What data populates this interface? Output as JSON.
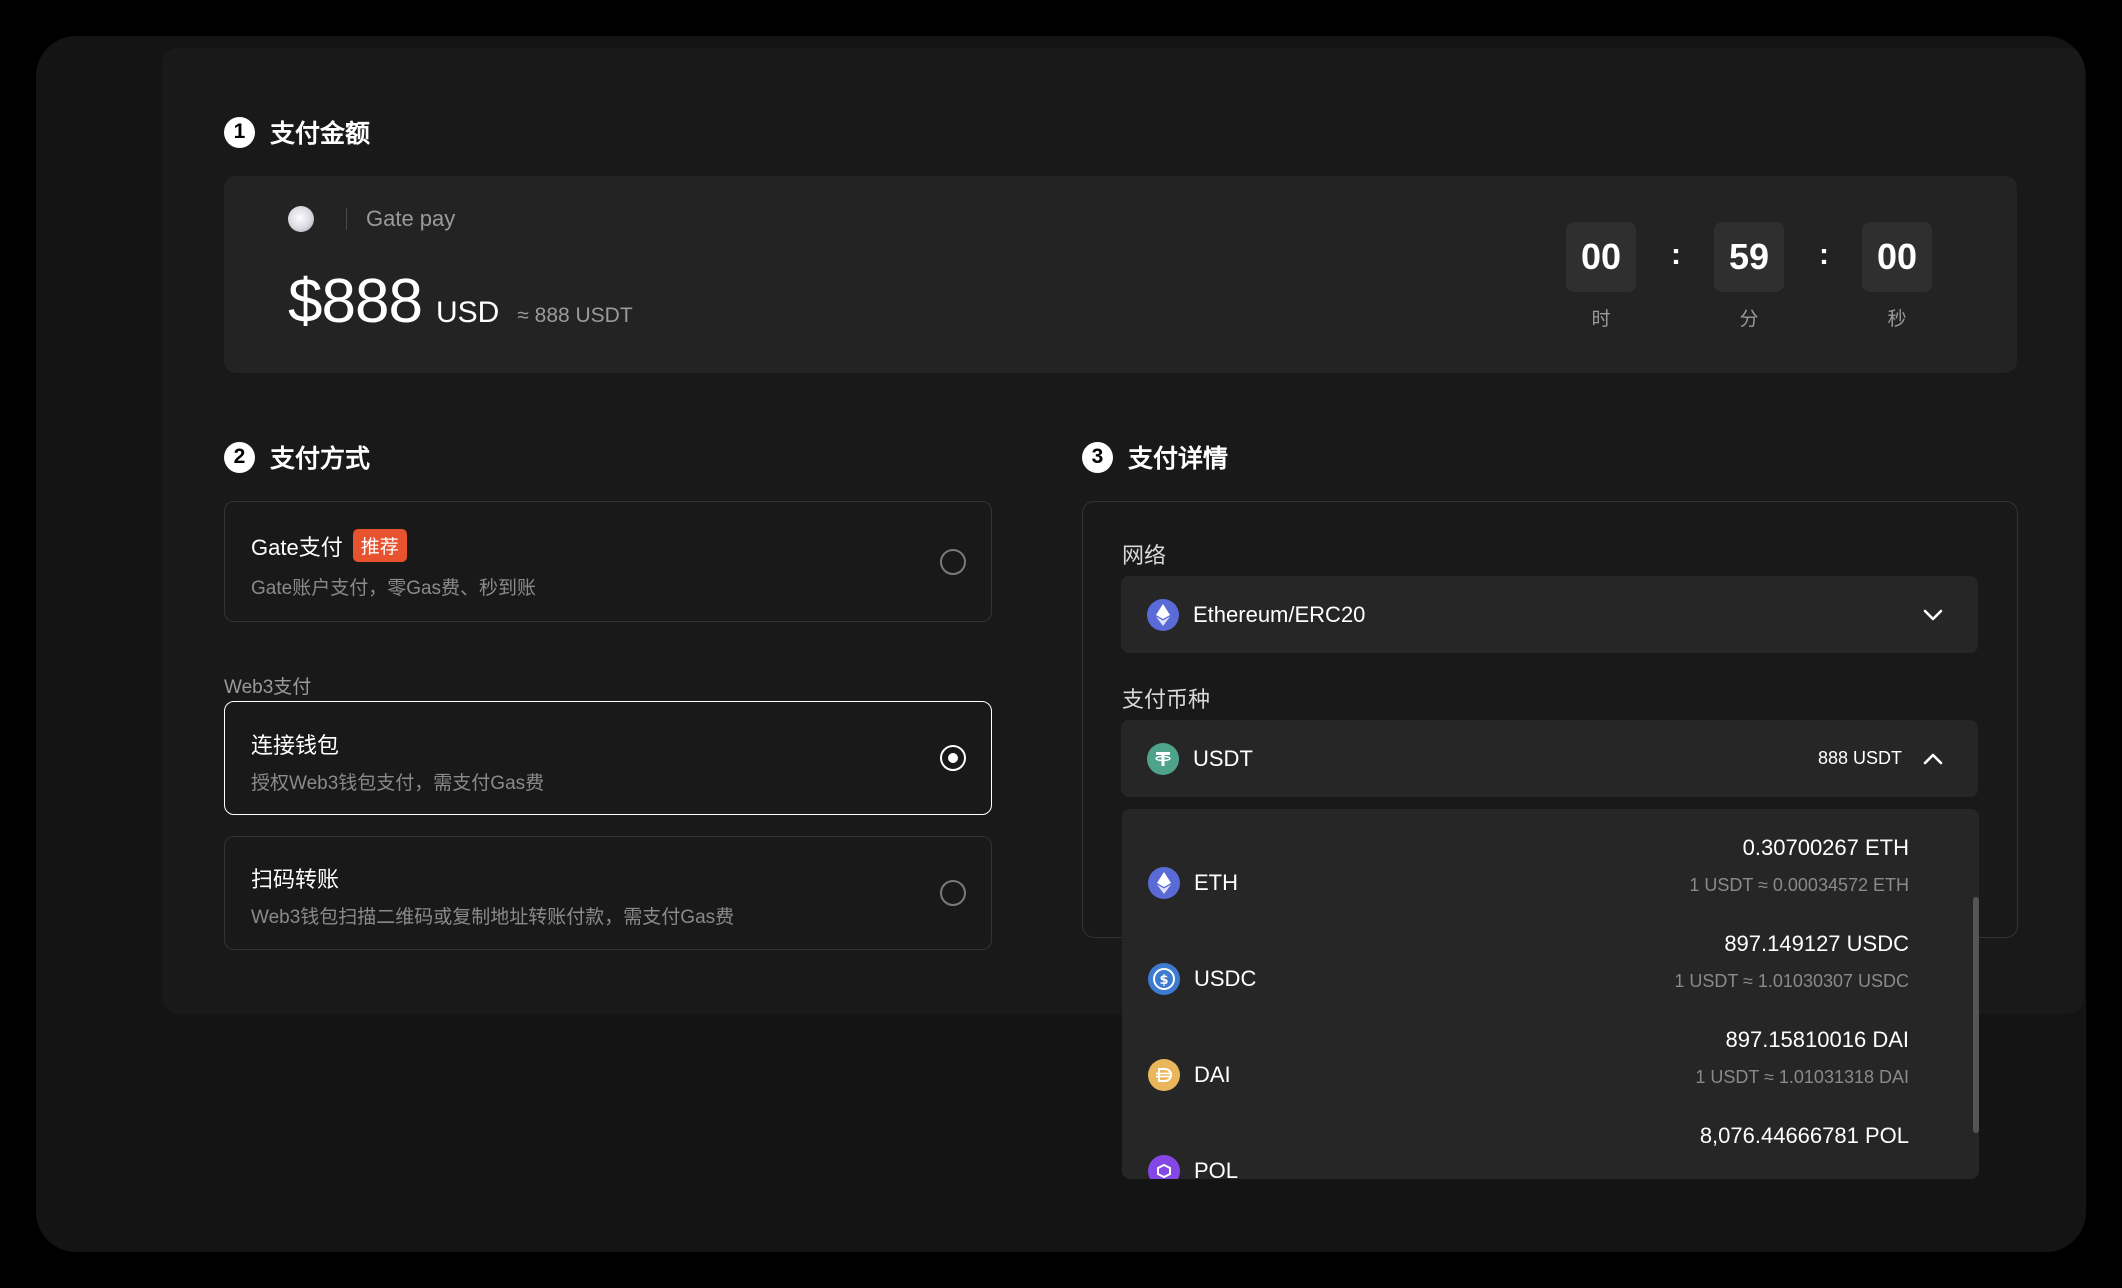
{
  "sections": {
    "amount": {
      "step": "1",
      "title": "支付金额"
    },
    "method": {
      "step": "2",
      "title": "支付方式"
    },
    "details": {
      "step": "3",
      "title": "支付详情"
    }
  },
  "merchant": {
    "name": "Gate pay",
    "logo_icon": "merchant-logo-icon"
  },
  "amount": {
    "value": "$888",
    "currency": "USD",
    "approx": "≈ 888 USDT"
  },
  "timer": {
    "hours": "00",
    "hours_label": "时",
    "minutes": "59",
    "minutes_label": "分",
    "seconds": "00",
    "seconds_label": "秒",
    "separator": ":"
  },
  "methods": {
    "gate": {
      "title": "Gate支付",
      "badge": "推荐",
      "desc": "Gate账户支付，零Gas费、秒到账",
      "selected": false
    },
    "web3_label": "Web3支付",
    "wallet": {
      "title": "连接钱包",
      "desc": "授权Web3钱包支付，需支付Gas费",
      "selected": true
    },
    "qr": {
      "title": "扫码转账",
      "desc": "Web3钱包扫描二维码或复制地址转账付款，需支付Gas费",
      "selected": false
    }
  },
  "details": {
    "network_label": "网络",
    "network_value": "Ethereum/ERC20",
    "currency_label": "支付币种",
    "currency_value": "USDT",
    "currency_amount": "888 USDT"
  },
  "dropdown": [
    {
      "symbol": "ETH",
      "amount": "0.30700267 ETH",
      "rate": "1 USDT ≈ 0.00034572 ETH",
      "color": "#5a6bd8"
    },
    {
      "symbol": "USDC",
      "amount": "897.149127 USDC",
      "rate": "1 USDT ≈ 1.01030307 USDC",
      "color": "#3d7bd0"
    },
    {
      "symbol": "DAI",
      "amount": "897.15810016 DAI",
      "rate": "1 USDT ≈ 1.01031318 DAI",
      "color": "#e9b65b"
    },
    {
      "symbol": "POL",
      "amount": "8,076.44666781 POL",
      "rate": "",
      "color": "#8247e5"
    }
  ],
  "colors": {
    "accent_badge": "#e8532f",
    "usdt": "#4fa38a",
    "eth": "#5a6bd8"
  }
}
